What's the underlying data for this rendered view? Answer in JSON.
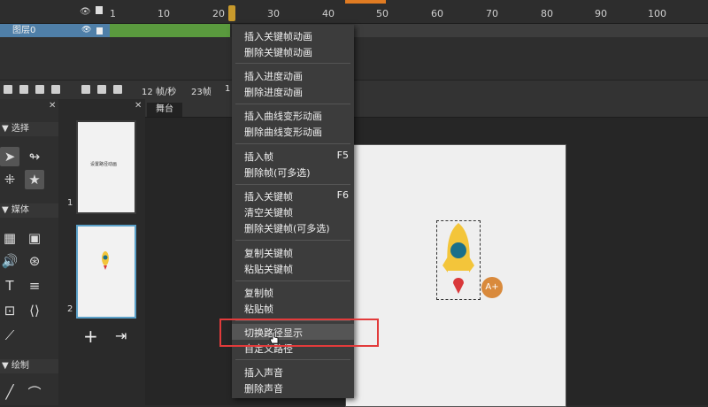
{
  "timeline": {
    "ticks": [
      "1",
      "10",
      "20",
      "30",
      "40",
      "50",
      "60",
      "70",
      "80",
      "90",
      "100"
    ],
    "layer_name": "图层0"
  },
  "toolbar": {
    "fps_label": "12 帧/秒",
    "frames_label": "23帧",
    "extra_label": "1"
  },
  "tool_panel": {
    "select_header": "▼ 选择",
    "media_header": "▼ 媒体",
    "draw_header": "▼ 绘制"
  },
  "pages": {
    "page1_num": "1",
    "page2_num": "2",
    "page1_title": "设置路径动画",
    "add_label": "+",
    "import_label": "⇥"
  },
  "stage": {
    "tab_label": "舞台"
  },
  "menu": {
    "groups": [
      [
        "插入关键帧动画",
        "删除关键帧动画"
      ],
      [
        "插入进度动画",
        "删除进度动画"
      ],
      [
        "插入曲线变形动画",
        "删除曲线变形动画"
      ],
      [
        "插入帧",
        "删除帧(可多选)"
      ],
      [
        "插入关键帧",
        "清空关键帧",
        "删除关键帧(可多选)"
      ],
      [
        "复制关键帧",
        "粘贴关键帧"
      ],
      [
        "复制帧",
        "粘贴帧"
      ],
      [
        "切换路径显示",
        "自定义路径"
      ],
      [
        "插入声音",
        "删除声音"
      ]
    ],
    "shortcut_insert_frame": "F5",
    "shortcut_insert_keyframe": "F6"
  },
  "colors": {
    "accent_red": "#e23b3b",
    "layer_blue": "#4f7fa8",
    "frames_green": "#5a9a3e",
    "rocket_teal": "#1a6f8a",
    "rocket_yellow": "#f3c53a",
    "rocket_red": "#d9383a",
    "badge_orange": "#d98a3c"
  },
  "badge_label": "A+"
}
